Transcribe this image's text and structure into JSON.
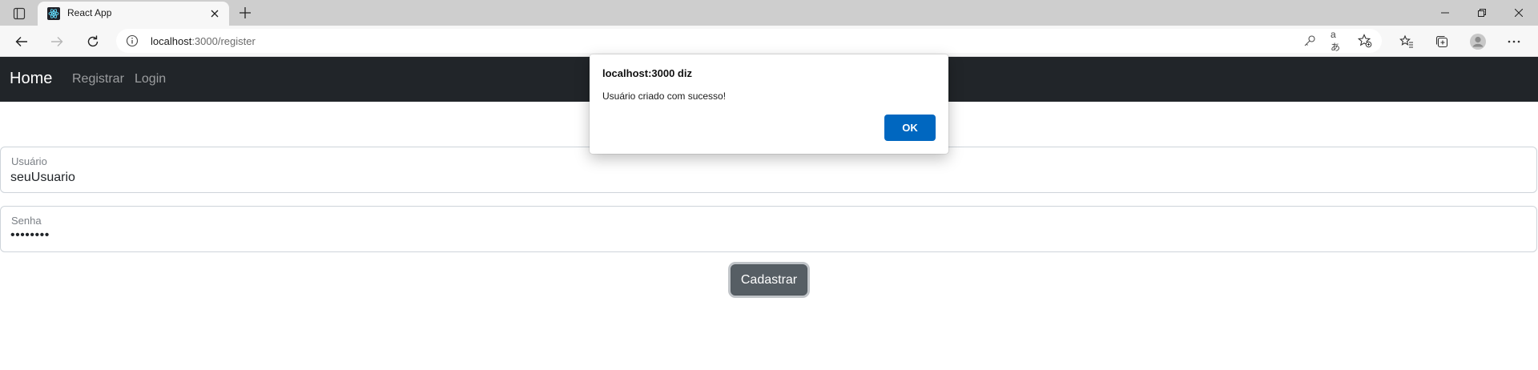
{
  "browser": {
    "tab": {
      "title": "React App"
    },
    "address": {
      "host": "localhost",
      "path": ":3000/register"
    }
  },
  "navbar": {
    "brand": "Home",
    "links": [
      "Registrar",
      "Login"
    ]
  },
  "form": {
    "username": {
      "label": "Usuário",
      "value": "seuUsuario"
    },
    "password": {
      "label": "Senha",
      "value": "••••••••"
    },
    "submit_label": "Cadastrar"
  },
  "dialog": {
    "title": "localhost:3000 diz",
    "message": "Usuário criado com sucesso!",
    "ok_label": "OK"
  },
  "colors": {
    "navbar_bg": "#212529",
    "submit_bg": "#565e64",
    "dialog_ok_bg": "#0067c0"
  }
}
